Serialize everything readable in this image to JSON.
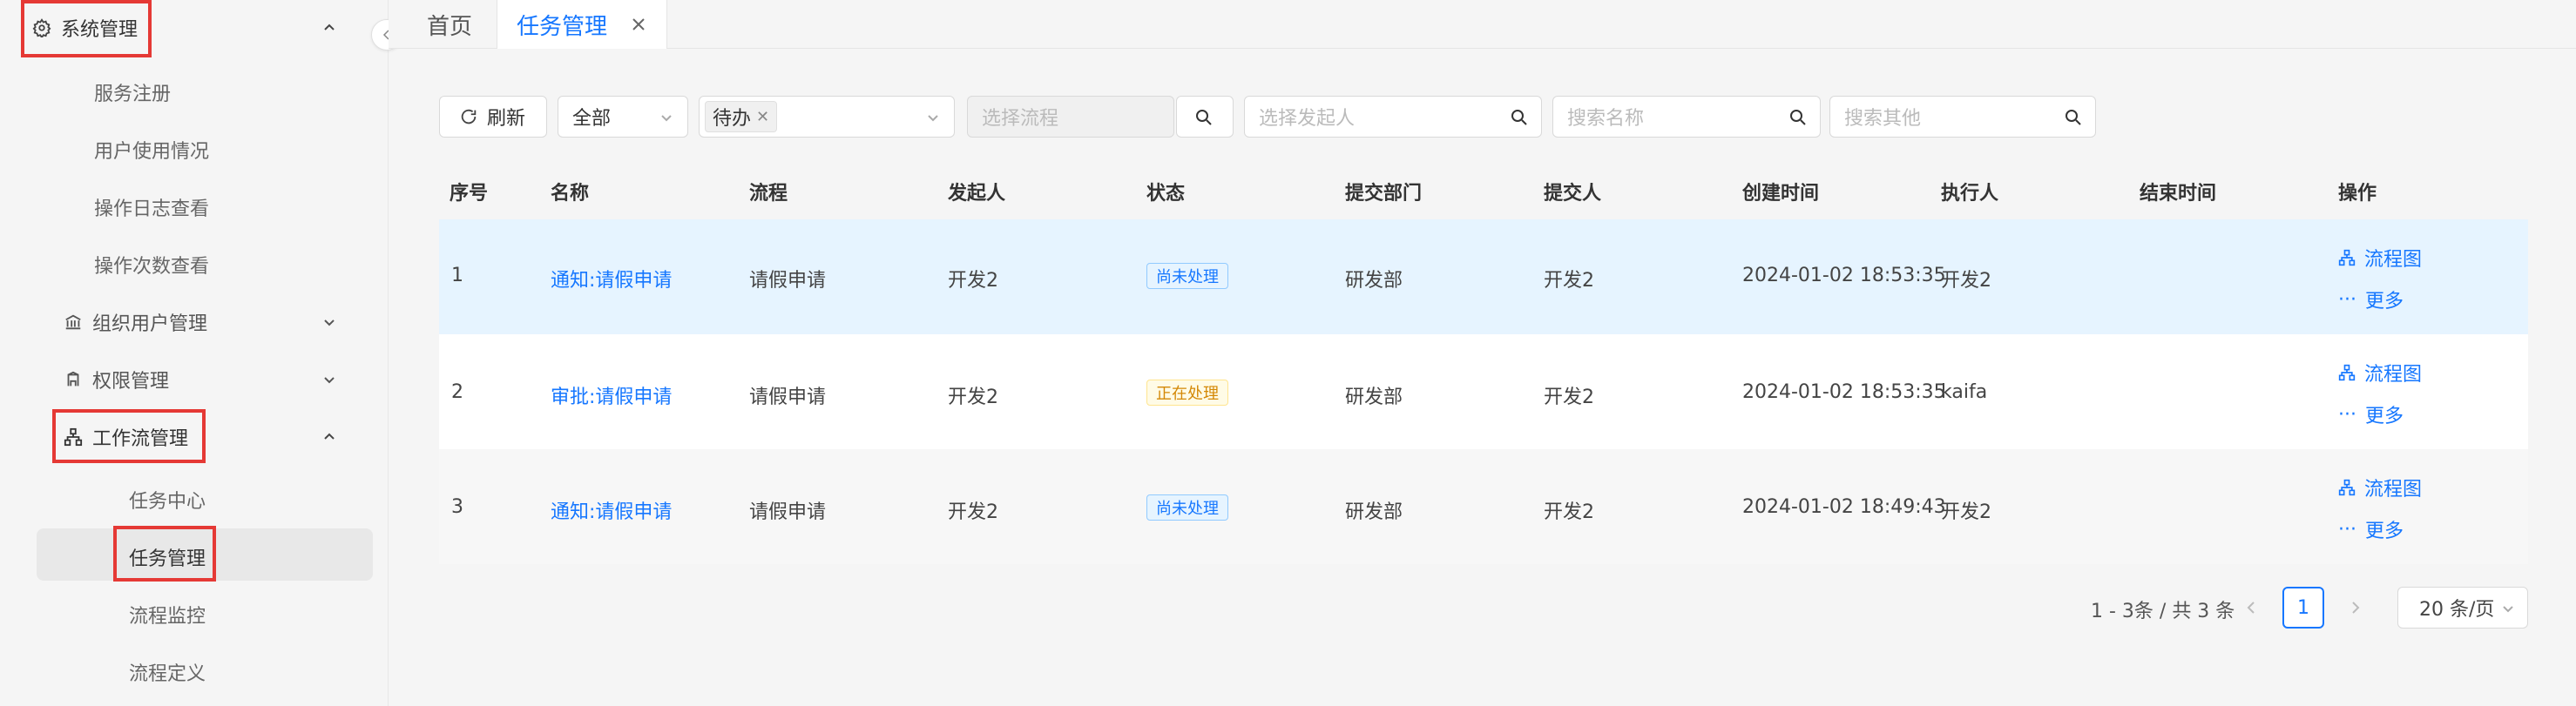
{
  "sidebar": {
    "system_management": "系统管理",
    "items": [
      "服务注册",
      "用户使用情况",
      "操作日志查看",
      "操作次数查看"
    ],
    "org_user_management": "组织用户管理",
    "permission_management": "权限管理",
    "workflow_management": "工作流管理",
    "workflow_items": [
      "任务中心",
      "任务管理",
      "流程监控",
      "流程定义"
    ]
  },
  "tabs": {
    "home": "首页",
    "task_management": "任务管理"
  },
  "filters": {
    "refresh": "刷新",
    "all": "全部",
    "status_tag": "待办",
    "process_placeholder": "选择流程",
    "initiator_placeholder": "选择发起人",
    "name_placeholder": "搜索名称",
    "other_placeholder": "搜索其他"
  },
  "table": {
    "headers": [
      "序号",
      "名称",
      "流程",
      "发起人",
      "状态",
      "提交部门",
      "提交人",
      "创建时间",
      "执行人",
      "结束时间",
      "操作"
    ],
    "rows": [
      {
        "no": "1",
        "name": "通知:请假申请",
        "process": "请假申请",
        "initiator": "开发2",
        "status": "尚未处理",
        "dept": "研发部",
        "submitter": "开发2",
        "created": "2024-01-02 18:53:35",
        "executor": "开发2",
        "end": ""
      },
      {
        "no": "2",
        "name": "审批:请假申请",
        "process": "请假申请",
        "initiator": "开发2",
        "status": "正在处理",
        "dept": "研发部",
        "submitter": "开发2",
        "created": "2024-01-02 18:53:35",
        "executor": "kaifa",
        "end": ""
      },
      {
        "no": "3",
        "name": "通知:请假申请",
        "process": "请假申请",
        "initiator": "开发2",
        "status": "尚未处理",
        "dept": "研发部",
        "submitter": "开发2",
        "created": "2024-01-02 18:49:43",
        "executor": "开发2",
        "end": ""
      }
    ],
    "op_flowchart": "流程图",
    "op_more": "更多"
  },
  "pagination": {
    "summary": "1 - 3条 / 共 3 条",
    "page": "1",
    "page_size": "20 条/页"
  },
  "colors": {
    "accent": "#1677ff",
    "highlight_row": "#e6f4ff",
    "redbox": "#e53935"
  }
}
